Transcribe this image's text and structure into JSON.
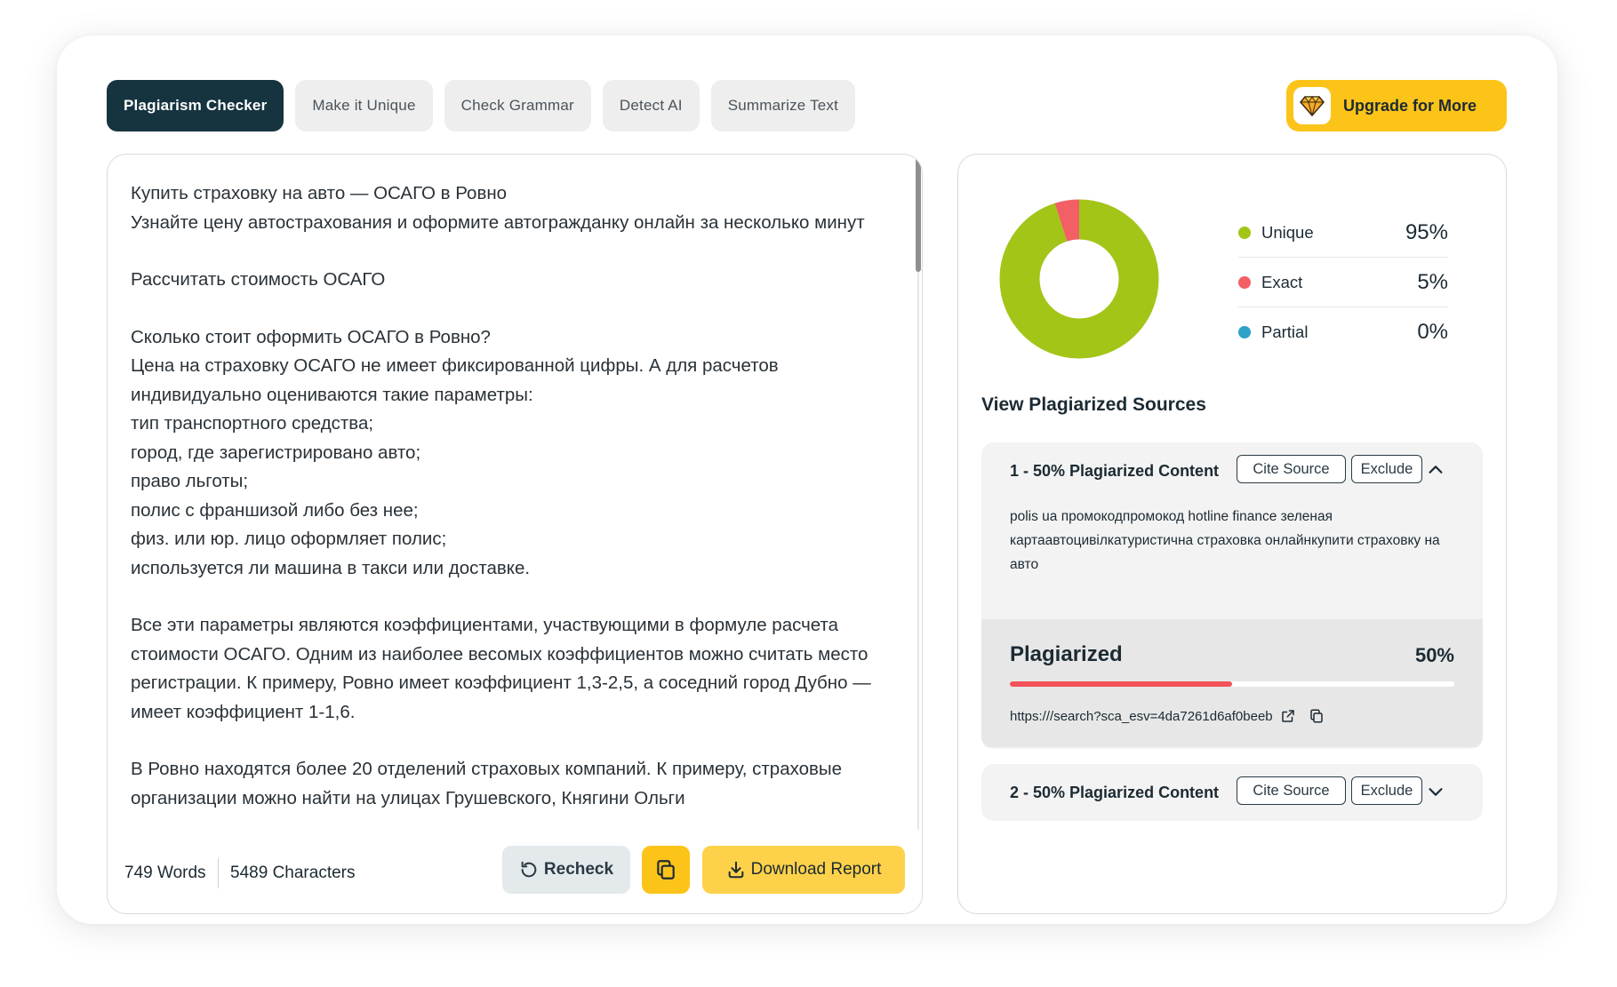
{
  "tabs": [
    {
      "label": "Plagiarism Checker",
      "active": true
    },
    {
      "label": "Make it Unique"
    },
    {
      "label": "Check Grammar"
    },
    {
      "label": "Detect AI"
    },
    {
      "label": "Summarize Text"
    }
  ],
  "upgrade": {
    "label": "Upgrade for More",
    "icon": "diamond-icon"
  },
  "editor": {
    "paragraphs": [
      "Купить страховку на авто — ОСАГО в Ровно\nУзнайте цену автострахования и оформите автогражданку онлайн за несколько минут",
      "Рассчитать стоимость ОСАГО",
      "Сколько стоит оформить ОСАГО в Ровно?\nЦена на страховку ОСАГО не имеет фиксированной цифры. А для расчетов индивидуально оцениваются такие параметры:\nтип транспортного средства;\nгород, где зарегистрировано авто;\nправо льготы;\nполис с франшизой либо без нее;\nфиз. или юр. лицо оформляет полис;\nиспользуется ли машина в такси или доставке.",
      "Все эти параметры являются коэффициентами, участвующими в формуле расчета стоимости ОСАГО. Одним из наиболее весомых коэффициентов можно считать место регистрации. К примеру, Ровно имеет коэффициент 1,3-2,5, а соседний город Дубно — имеет коэффициент 1-1,6.",
      "В Ровно находятся более 20 отделений страховых компаний. К примеру, страховые организации можно найти на улицах Грушевского, Княгини Ольги"
    ],
    "words": "749 Words",
    "characters": "5489 Characters",
    "recheck_label": "Recheck",
    "download_label": "Download Report"
  },
  "results": {
    "legend": [
      {
        "label": "Unique",
        "value": "95%",
        "color": "#a3c517"
      },
      {
        "label": "Exact",
        "value": "5%",
        "color": "#f25f64"
      },
      {
        "label": "Partial",
        "value": "0%",
        "color": "#2ea3c9"
      }
    ],
    "donut": {
      "unique": 0.95,
      "exact": 0.05,
      "partial": 0.0
    },
    "sources_title": "View Plagiarized Sources",
    "sources": [
      {
        "title": "1 - 50% Plagiarized Content",
        "cite_label": "Cite Source",
        "exclude_label": "Exclude",
        "expanded": true,
        "snippet": "polis ua промокодпромокод hotline finance зеленая картаавтоцивілкатуристична страховка онлайнкупити страховку на авто",
        "stat_label": "Plagiarized",
        "stat_value": "50%",
        "stat_fraction": 0.5,
        "url": "https:///search?sca_esv=4da7261d6af0beeb"
      },
      {
        "title": "2 - 50% Plagiarized Content",
        "cite_label": "Cite Source",
        "exclude_label": "Exclude",
        "expanded": false
      }
    ]
  }
}
